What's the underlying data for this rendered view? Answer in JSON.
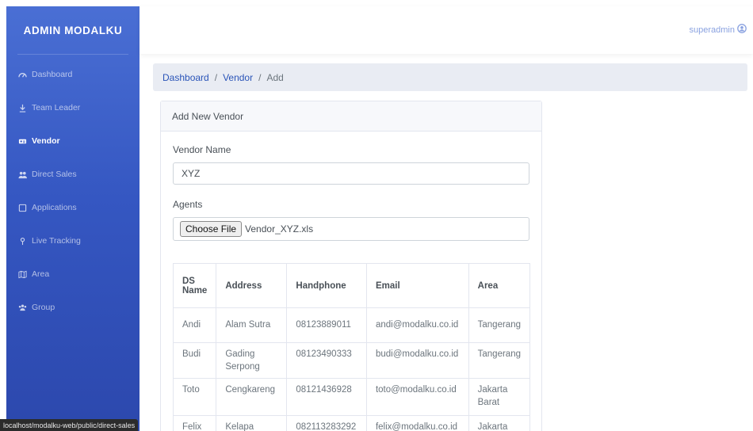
{
  "sidebar": {
    "brand": "ADMIN MODALKU",
    "items": [
      {
        "label": "Dashboard",
        "icon": "dashboard-icon"
      },
      {
        "label": "Team Leader",
        "icon": "team-leader-icon"
      },
      {
        "label": "Vendor",
        "icon": "vendor-icon",
        "active": true
      },
      {
        "label": "Direct Sales",
        "icon": "users-icon"
      },
      {
        "label": "Applications",
        "icon": "applications-icon"
      },
      {
        "label": "Live Tracking",
        "icon": "map-pin-icon"
      },
      {
        "label": "Area",
        "icon": "map-icon"
      },
      {
        "label": "Group",
        "icon": "group-icon"
      }
    ]
  },
  "header": {
    "user": "superadmin",
    "user_icon": "user-circle-icon"
  },
  "breadcrumb": {
    "items": [
      "Dashboard",
      "Vendor"
    ],
    "current": "Add",
    "separator": "/"
  },
  "form": {
    "title": "Add New Vendor",
    "vendor_name_label": "Vendor Name",
    "vendor_name_value": "XYZ",
    "agents_label": "Agents",
    "choose_file_label": "Choose File",
    "file_name": "Vendor_XYZ.xls"
  },
  "table": {
    "headers": [
      "DS Name",
      "Address",
      "Handphone",
      "Email",
      "Area"
    ],
    "rows": [
      [
        "Andi",
        "Alam Sutra",
        "08123889011",
        "andi@modalku.co.id",
        "Tangerang"
      ],
      [
        "Budi",
        "Gading Serpong",
        "08123490333",
        "budi@modalku.co.id",
        "Tangerang"
      ],
      [
        "Toto",
        "Cengkareng",
        "08121436928",
        "toto@modalku.co.id",
        "Jakarta Barat"
      ],
      [
        "Felix",
        "Kelapa",
        "082113283292",
        "felix@modalku.co.id",
        "Jakarta"
      ]
    ]
  },
  "status_url": "localhost/modalku-web/public/direct-sales",
  "colors": {
    "sidebar_top": "#4a6fd4",
    "sidebar_bottom": "#2c48ad",
    "link": "#2a54b8",
    "user": "#8aa2e0"
  }
}
